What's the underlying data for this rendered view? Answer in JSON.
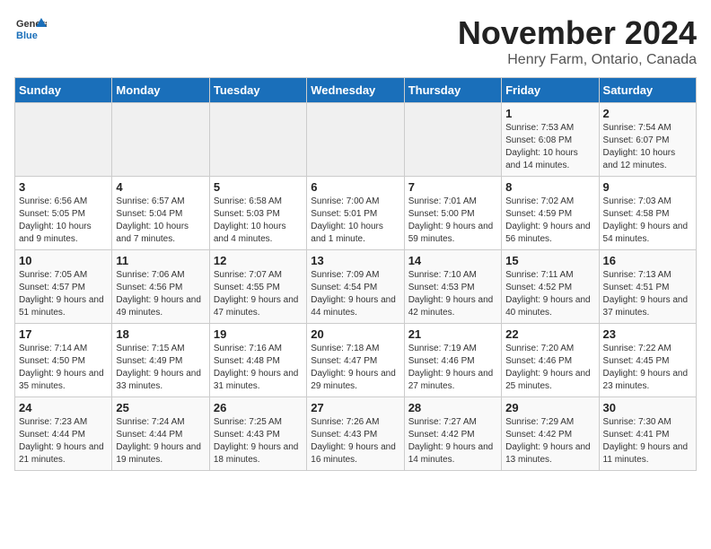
{
  "logo": {
    "line1": "General",
    "line2": "Blue"
  },
  "title": "November 2024",
  "subtitle": "Henry Farm, Ontario, Canada",
  "days_header": [
    "Sunday",
    "Monday",
    "Tuesday",
    "Wednesday",
    "Thursday",
    "Friday",
    "Saturday"
  ],
  "weeks": [
    [
      {
        "day": "",
        "info": ""
      },
      {
        "day": "",
        "info": ""
      },
      {
        "day": "",
        "info": ""
      },
      {
        "day": "",
        "info": ""
      },
      {
        "day": "",
        "info": ""
      },
      {
        "day": "1",
        "info": "Sunrise: 7:53 AM\nSunset: 6:08 PM\nDaylight: 10 hours and 14 minutes."
      },
      {
        "day": "2",
        "info": "Sunrise: 7:54 AM\nSunset: 6:07 PM\nDaylight: 10 hours and 12 minutes."
      }
    ],
    [
      {
        "day": "3",
        "info": "Sunrise: 6:56 AM\nSunset: 5:05 PM\nDaylight: 10 hours and 9 minutes."
      },
      {
        "day": "4",
        "info": "Sunrise: 6:57 AM\nSunset: 5:04 PM\nDaylight: 10 hours and 7 minutes."
      },
      {
        "day": "5",
        "info": "Sunrise: 6:58 AM\nSunset: 5:03 PM\nDaylight: 10 hours and 4 minutes."
      },
      {
        "day": "6",
        "info": "Sunrise: 7:00 AM\nSunset: 5:01 PM\nDaylight: 10 hours and 1 minute."
      },
      {
        "day": "7",
        "info": "Sunrise: 7:01 AM\nSunset: 5:00 PM\nDaylight: 9 hours and 59 minutes."
      },
      {
        "day": "8",
        "info": "Sunrise: 7:02 AM\nSunset: 4:59 PM\nDaylight: 9 hours and 56 minutes."
      },
      {
        "day": "9",
        "info": "Sunrise: 7:03 AM\nSunset: 4:58 PM\nDaylight: 9 hours and 54 minutes."
      }
    ],
    [
      {
        "day": "10",
        "info": "Sunrise: 7:05 AM\nSunset: 4:57 PM\nDaylight: 9 hours and 51 minutes."
      },
      {
        "day": "11",
        "info": "Sunrise: 7:06 AM\nSunset: 4:56 PM\nDaylight: 9 hours and 49 minutes."
      },
      {
        "day": "12",
        "info": "Sunrise: 7:07 AM\nSunset: 4:55 PM\nDaylight: 9 hours and 47 minutes."
      },
      {
        "day": "13",
        "info": "Sunrise: 7:09 AM\nSunset: 4:54 PM\nDaylight: 9 hours and 44 minutes."
      },
      {
        "day": "14",
        "info": "Sunrise: 7:10 AM\nSunset: 4:53 PM\nDaylight: 9 hours and 42 minutes."
      },
      {
        "day": "15",
        "info": "Sunrise: 7:11 AM\nSunset: 4:52 PM\nDaylight: 9 hours and 40 minutes."
      },
      {
        "day": "16",
        "info": "Sunrise: 7:13 AM\nSunset: 4:51 PM\nDaylight: 9 hours and 37 minutes."
      }
    ],
    [
      {
        "day": "17",
        "info": "Sunrise: 7:14 AM\nSunset: 4:50 PM\nDaylight: 9 hours and 35 minutes."
      },
      {
        "day": "18",
        "info": "Sunrise: 7:15 AM\nSunset: 4:49 PM\nDaylight: 9 hours and 33 minutes."
      },
      {
        "day": "19",
        "info": "Sunrise: 7:16 AM\nSunset: 4:48 PM\nDaylight: 9 hours and 31 minutes."
      },
      {
        "day": "20",
        "info": "Sunrise: 7:18 AM\nSunset: 4:47 PM\nDaylight: 9 hours and 29 minutes."
      },
      {
        "day": "21",
        "info": "Sunrise: 7:19 AM\nSunset: 4:46 PM\nDaylight: 9 hours and 27 minutes."
      },
      {
        "day": "22",
        "info": "Sunrise: 7:20 AM\nSunset: 4:46 PM\nDaylight: 9 hours and 25 minutes."
      },
      {
        "day": "23",
        "info": "Sunrise: 7:22 AM\nSunset: 4:45 PM\nDaylight: 9 hours and 23 minutes."
      }
    ],
    [
      {
        "day": "24",
        "info": "Sunrise: 7:23 AM\nSunset: 4:44 PM\nDaylight: 9 hours and 21 minutes."
      },
      {
        "day": "25",
        "info": "Sunrise: 7:24 AM\nSunset: 4:44 PM\nDaylight: 9 hours and 19 minutes."
      },
      {
        "day": "26",
        "info": "Sunrise: 7:25 AM\nSunset: 4:43 PM\nDaylight: 9 hours and 18 minutes."
      },
      {
        "day": "27",
        "info": "Sunrise: 7:26 AM\nSunset: 4:43 PM\nDaylight: 9 hours and 16 minutes."
      },
      {
        "day": "28",
        "info": "Sunrise: 7:27 AM\nSunset: 4:42 PM\nDaylight: 9 hours and 14 minutes."
      },
      {
        "day": "29",
        "info": "Sunrise: 7:29 AM\nSunset: 4:42 PM\nDaylight: 9 hours and 13 minutes."
      },
      {
        "day": "30",
        "info": "Sunrise: 7:30 AM\nSunset: 4:41 PM\nDaylight: 9 hours and 11 minutes."
      }
    ]
  ]
}
